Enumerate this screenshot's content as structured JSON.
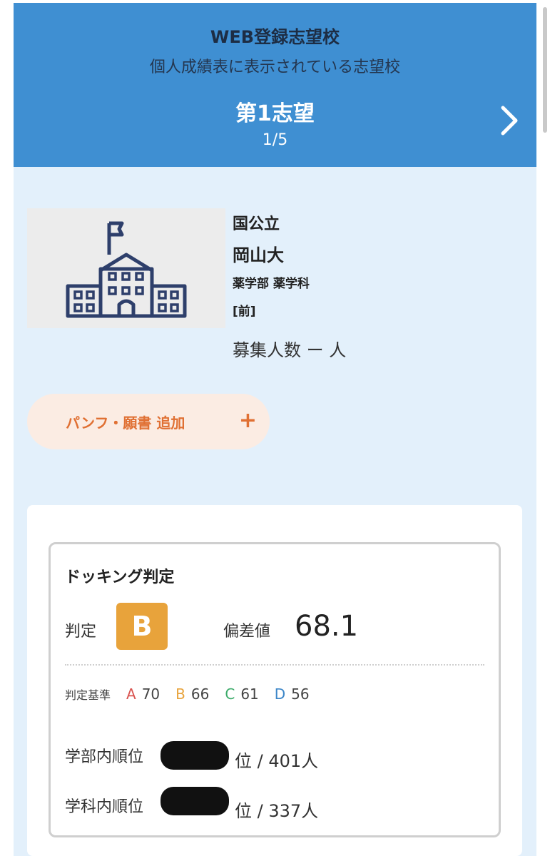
{
  "header": {
    "title": "WEB登録志望校",
    "subtitle": "個人成績表に表示されている志望校",
    "choice_label": "第1志望",
    "pager": "1/5",
    "next_icon": "chevron-right-icon"
  },
  "school": {
    "image_icon": "school-building-icon",
    "kind": "国公立",
    "university": "岡山大",
    "department": "薬学部 薬学科",
    "schedule": "[前]",
    "capacity": "募集人数 ー 人"
  },
  "add_button": {
    "label": "パンフ・願書 追加",
    "icon": "plus-icon"
  },
  "judgment": {
    "title": "ドッキング判定",
    "judge_label": "判定",
    "grade": "B",
    "deviation_label": "偏差値",
    "deviation_value": "68.1",
    "criteria_label": "判定基準",
    "criteria": [
      {
        "grade": "A",
        "value": "70",
        "color": "#d9534f"
      },
      {
        "grade": "B",
        "value": "66",
        "color": "#e8a33b"
      },
      {
        "grade": "C",
        "value": "61",
        "color": "#3cab6a"
      },
      {
        "grade": "D",
        "value": "56",
        "color": "#3c86c8"
      }
    ],
    "faculty_rank_label": "学部内順位",
    "faculty_rank_suffix": "位 / 401人",
    "dept_rank_label": "学科内順位",
    "dept_rank_suffix": "位 / 337人"
  },
  "colors": {
    "header_bg": "#3f8fd2",
    "panel_bg": "#e3f0fb",
    "accent_orange": "#e07033",
    "grade_b": "#e8a33b"
  }
}
